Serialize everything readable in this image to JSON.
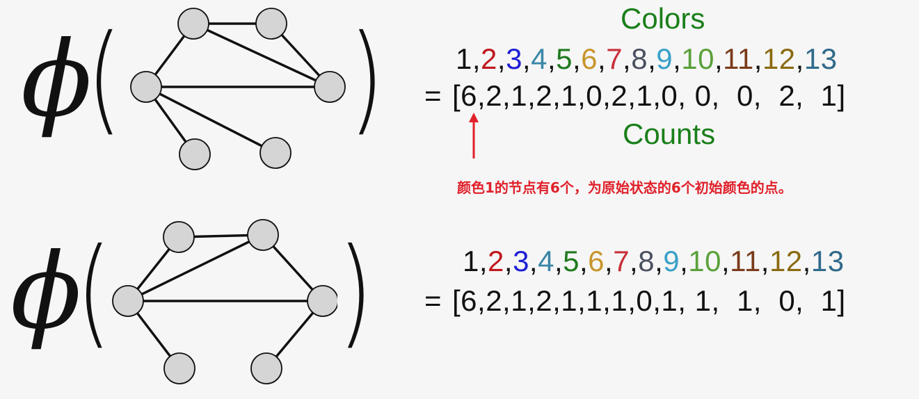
{
  "diagrams": [
    {
      "phi": "ϕ",
      "open_paren": "(",
      "close_paren": ")",
      "colors_title": "Colors",
      "counts_title": "Counts",
      "equals": "=",
      "note": "颜色1的节点有6个，为原始状态的6个初始颜色的点。",
      "colors": [
        {
          "t": "1",
          "c": "#111111"
        },
        {
          "t": ",",
          "c": "#111111"
        },
        {
          "t": "2",
          "c": "#c0181e"
        },
        {
          "t": ",",
          "c": "#111111"
        },
        {
          "t": "3",
          "c": "#1f1fd6"
        },
        {
          "t": ",",
          "c": "#111111"
        },
        {
          "t": "4",
          "c": "#3a87a8"
        },
        {
          "t": ",",
          "c": "#111111"
        },
        {
          "t": "5",
          "c": "#1f7a1f"
        },
        {
          "t": ",",
          "c": "#111111"
        },
        {
          "t": "6",
          "c": "#c7952b"
        },
        {
          "t": ",",
          "c": "#111111"
        },
        {
          "t": "7",
          "c": "#c8303a"
        },
        {
          "t": ",",
          "c": "#111111"
        },
        {
          "t": "8",
          "c": "#4a5060"
        },
        {
          "t": ",",
          "c": "#111111"
        },
        {
          "t": "9",
          "c": "#3aa0c8"
        },
        {
          "t": ",",
          "c": "#111111"
        },
        {
          "t": "10",
          "c": "#5aa03a"
        },
        {
          "t": ",",
          "c": "#111111"
        },
        {
          "t": "11",
          "c": "#7a3a1a"
        },
        {
          "t": ",",
          "c": "#111111"
        },
        {
          "t": "12",
          "c": "#8a6a10"
        },
        {
          "t": ",",
          "c": "#111111"
        },
        {
          "t": "13",
          "c": "#2f6a8a"
        }
      ],
      "counts_text": "[6,2,1,2,1,0,2,1,0, 0,  0,  2,  1]"
    },
    {
      "phi": "ϕ",
      "open_paren": "(",
      "close_paren": ")",
      "equals": "=",
      "colors": [
        {
          "t": "1",
          "c": "#111111"
        },
        {
          "t": ",",
          "c": "#111111"
        },
        {
          "t": "2",
          "c": "#c0181e"
        },
        {
          "t": ",",
          "c": "#111111"
        },
        {
          "t": "3",
          "c": "#1f1fd6"
        },
        {
          "t": ",",
          "c": "#111111"
        },
        {
          "t": "4",
          "c": "#3a87a8"
        },
        {
          "t": ",",
          "c": "#111111"
        },
        {
          "t": "5",
          "c": "#1f7a1f"
        },
        {
          "t": ",",
          "c": "#111111"
        },
        {
          "t": "6",
          "c": "#c7952b"
        },
        {
          "t": ",",
          "c": "#111111"
        },
        {
          "t": "7",
          "c": "#c8303a"
        },
        {
          "t": ",",
          "c": "#111111"
        },
        {
          "t": "8",
          "c": "#4a5060"
        },
        {
          "t": ",",
          "c": "#111111"
        },
        {
          "t": "9",
          "c": "#3aa0c8"
        },
        {
          "t": ",",
          "c": "#111111"
        },
        {
          "t": "10",
          "c": "#5aa03a"
        },
        {
          "t": ",",
          "c": "#111111"
        },
        {
          "t": "11",
          "c": "#7a3a1a"
        },
        {
          "t": ",",
          "c": "#111111"
        },
        {
          "t": "12",
          "c": "#8a6a10"
        },
        {
          "t": ",",
          "c": "#111111"
        },
        {
          "t": "13",
          "c": "#2f6a8a"
        }
      ],
      "counts_text": "[6,2,1,2,1,1,1,0,1, 1,  1,  0,  1]"
    }
  ],
  "theme": {
    "node_fill": "#d5d5d5",
    "edge_color": "#111111",
    "title_green": "#1a7f1a",
    "note_red": "#e0202a"
  }
}
